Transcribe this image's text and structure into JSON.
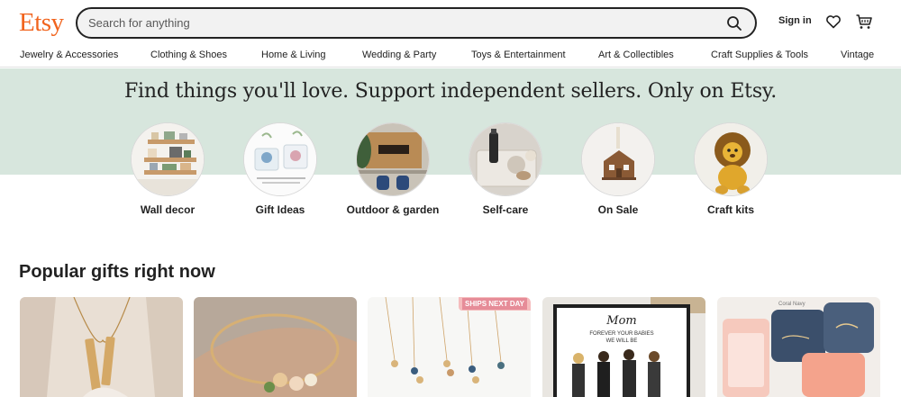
{
  "header": {
    "logo": "Etsy",
    "search_placeholder": "Search for anything",
    "sign_in": "Sign in"
  },
  "categories": [
    "Jewelry & Accessories",
    "Clothing & Shoes",
    "Home & Living",
    "Wedding & Party",
    "Toys & Entertainment",
    "Art & Collectibles",
    "Craft Supplies & Tools",
    "Vintage"
  ],
  "hero": {
    "title": "Find things you'll love. Support independent sellers. Only on Etsy.",
    "circles": [
      {
        "label": "Wall decor"
      },
      {
        "label": "Gift Ideas"
      },
      {
        "label": "Outdoor & garden"
      },
      {
        "label": "Self-care"
      },
      {
        "label": "On Sale"
      },
      {
        "label": "Craft kits"
      }
    ]
  },
  "popular": {
    "title": "Popular gifts right now",
    "cards": [
      {
        "image": "bar-necklace"
      },
      {
        "image": "initial-bracelet"
      },
      {
        "image": "birthstone-necklaces",
        "badge": "SHIPS NEXT DAY"
      },
      {
        "image": "mom-family-print",
        "print_title": "Mom",
        "print_caption_1": "FOREVER YOUR BABIES",
        "print_caption_2": "WE WILL BE"
      },
      {
        "image": "jewelry-boxes",
        "box_text": "Coral Navy"
      }
    ]
  },
  "colors": {
    "brand": "#f1641e",
    "hero_band": "#d7e6dd",
    "text": "#222222"
  }
}
